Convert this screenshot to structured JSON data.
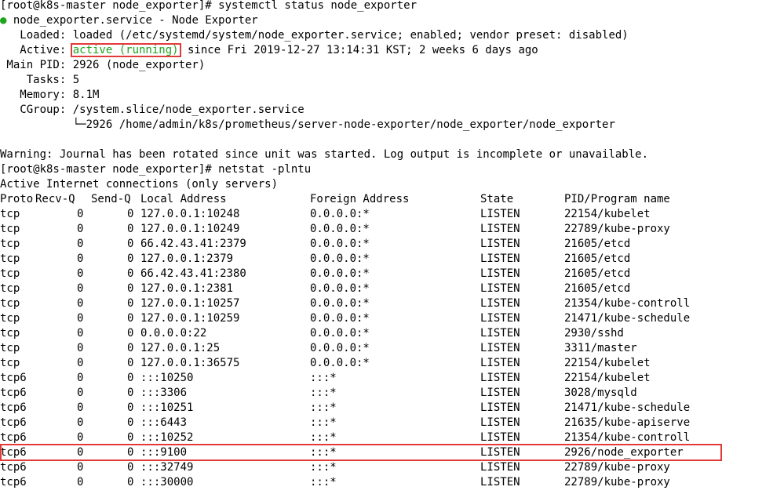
{
  "status": {
    "prompt1": "[root@k8s-master node_exporter]# systemctl status node_exporter",
    "service_line": "node_exporter.service - Node Exporter",
    "bullet": "●",
    "loaded": "   Loaded: loaded (/etc/systemd/system/node_exporter.service; enabled; vendor preset: disabled)",
    "active_label": "   Active: ",
    "active_value": "active (running)",
    "active_rest": " since Fri 2019-12-27 13:14:31 KST; 2 weeks 6 days ago",
    "main_pid": " Main PID: 2926 (node_exporter)",
    "tasks": "    Tasks: 5",
    "memory": "   Memory: 8.1M",
    "cgroup": "   CGroup: /system.slice/node_exporter.service",
    "cgroup_child": "           └─2926 /home/admin/k8s/prometheus/server-node-exporter/node_exporter/node_exporter",
    "warning": "Warning: Journal has been rotated since unit was started. Log output is incomplete or unavailable.",
    "prompt2": "[root@k8s-master node_exporter]# netstat -plntu",
    "netstat_title": "Active Internet connections (only servers)"
  },
  "netstat": {
    "headers": {
      "proto": "Proto",
      "recv": "Recv-Q",
      "send": "Send-Q",
      "local": "Local Address",
      "foreign": "Foreign Address",
      "state": "State",
      "pid": "PID/Program name"
    },
    "rows": [
      {
        "proto": "tcp",
        "recv": "0",
        "send": "0",
        "local": "127.0.0.1:10248",
        "foreign": "0.0.0.0:*",
        "state": "LISTEN",
        "pid": "22154/kubelet"
      },
      {
        "proto": "tcp",
        "recv": "0",
        "send": "0",
        "local": "127.0.0.1:10249",
        "foreign": "0.0.0.0:*",
        "state": "LISTEN",
        "pid": "22789/kube-proxy"
      },
      {
        "proto": "tcp",
        "recv": "0",
        "send": "0",
        "local": "66.42.43.41:2379",
        "foreign": "0.0.0.0:*",
        "state": "LISTEN",
        "pid": "21605/etcd"
      },
      {
        "proto": "tcp",
        "recv": "0",
        "send": "0",
        "local": "127.0.0.1:2379",
        "foreign": "0.0.0.0:*",
        "state": "LISTEN",
        "pid": "21605/etcd"
      },
      {
        "proto": "tcp",
        "recv": "0",
        "send": "0",
        "local": "66.42.43.41:2380",
        "foreign": "0.0.0.0:*",
        "state": "LISTEN",
        "pid": "21605/etcd"
      },
      {
        "proto": "tcp",
        "recv": "0",
        "send": "0",
        "local": "127.0.0.1:2381",
        "foreign": "0.0.0.0:*",
        "state": "LISTEN",
        "pid": "21605/etcd"
      },
      {
        "proto": "tcp",
        "recv": "0",
        "send": "0",
        "local": "127.0.0.1:10257",
        "foreign": "0.0.0.0:*",
        "state": "LISTEN",
        "pid": "21354/kube-controll"
      },
      {
        "proto": "tcp",
        "recv": "0",
        "send": "0",
        "local": "127.0.0.1:10259",
        "foreign": "0.0.0.0:*",
        "state": "LISTEN",
        "pid": "21471/kube-schedule"
      },
      {
        "proto": "tcp",
        "recv": "0",
        "send": "0",
        "local": "0.0.0.0:22",
        "foreign": "0.0.0.0:*",
        "state": "LISTEN",
        "pid": "2930/sshd"
      },
      {
        "proto": "tcp",
        "recv": "0",
        "send": "0",
        "local": "127.0.0.1:25",
        "foreign": "0.0.0.0:*",
        "state": "LISTEN",
        "pid": "3311/master"
      },
      {
        "proto": "tcp",
        "recv": "0",
        "send": "0",
        "local": "127.0.0.1:36575",
        "foreign": "0.0.0.0:*",
        "state": "LISTEN",
        "pid": "22154/kubelet"
      },
      {
        "proto": "tcp6",
        "recv": "0",
        "send": "0",
        "local": ":::10250",
        "foreign": ":::*",
        "state": "LISTEN",
        "pid": "22154/kubelet"
      },
      {
        "proto": "tcp6",
        "recv": "0",
        "send": "0",
        "local": ":::3306",
        "foreign": ":::*",
        "state": "LISTEN",
        "pid": "3028/mysqld"
      },
      {
        "proto": "tcp6",
        "recv": "0",
        "send": "0",
        "local": ":::10251",
        "foreign": ":::*",
        "state": "LISTEN",
        "pid": "21471/kube-schedule"
      },
      {
        "proto": "tcp6",
        "recv": "0",
        "send": "0",
        "local": ":::6443",
        "foreign": ":::*",
        "state": "LISTEN",
        "pid": "21635/kube-apiserve"
      },
      {
        "proto": "tcp6",
        "recv": "0",
        "send": "0",
        "local": ":::10252",
        "foreign": ":::*",
        "state": "LISTEN",
        "pid": "21354/kube-controll"
      },
      {
        "proto": "tcp6",
        "recv": "0",
        "send": "0",
        "local": ":::9100",
        "foreign": ":::*",
        "state": "LISTEN",
        "pid": "2926/node_exporter"
      },
      {
        "proto": "tcp6",
        "recv": "0",
        "send": "0",
        "local": ":::32749",
        "foreign": ":::*",
        "state": "LISTEN",
        "pid": "22789/kube-proxy"
      },
      {
        "proto": "tcp6",
        "recv": "0",
        "send": "0",
        "local": ":::30000",
        "foreign": ":::*",
        "state": "LISTEN",
        "pid": "22789/kube-proxy"
      }
    ]
  },
  "colors": {
    "active_green": "#1ea51e",
    "highlight_red": "#e23a3a"
  }
}
